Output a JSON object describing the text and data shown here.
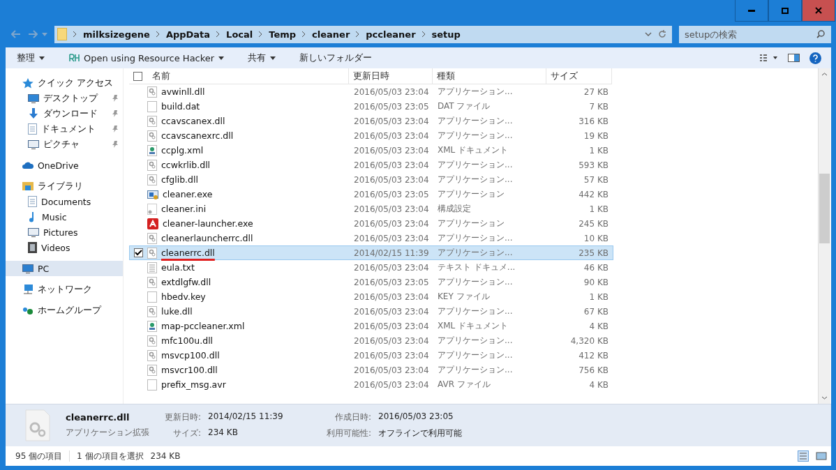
{
  "address": {
    "crumbs": [
      "milksizegene",
      "AppData",
      "Local",
      "Temp",
      "cleaner",
      "pccleaner",
      "setup"
    ]
  },
  "search": {
    "placeholder": "setupの検索"
  },
  "toolbar": [
    {
      "label": "整理",
      "kind": "menu"
    },
    {
      "label": "Open using Resource Hacker",
      "kind": "app"
    },
    {
      "label": "共有",
      "kind": "menu"
    },
    {
      "label": "新しいフォルダー",
      "kind": "plain"
    }
  ],
  "sidebar": [
    {
      "label": "クイック アクセス",
      "kind": "star",
      "selected": false,
      "children": [
        {
          "label": "デスクトップ",
          "kind": "desktop",
          "pinned": true,
          "selected": false
        },
        {
          "label": "ダウンロード",
          "kind": "download",
          "pinned": true,
          "selected": false
        },
        {
          "label": "ドキュメント",
          "kind": "document",
          "pinned": true,
          "selected": false
        },
        {
          "label": "ピクチャ",
          "kind": "picture",
          "pinned": true,
          "selected": false
        }
      ]
    },
    {
      "label": "OneDrive",
      "kind": "cloud",
      "selected": false
    },
    {
      "label": "ライブラリ",
      "kind": "library",
      "selected": false,
      "children": [
        {
          "label": "Documents",
          "kind": "document",
          "pinned": false,
          "selected": false
        },
        {
          "label": "Music",
          "kind": "music",
          "pinned": false,
          "selected": false
        },
        {
          "label": "Pictures",
          "kind": "picture",
          "pinned": false,
          "selected": false
        },
        {
          "label": "Videos",
          "kind": "video",
          "pinned": false,
          "selected": false
        }
      ]
    },
    {
      "label": "PC",
      "kind": "pc",
      "selected": true
    },
    {
      "label": "ネットワーク",
      "kind": "network",
      "selected": false
    },
    {
      "label": "ホームグループ",
      "kind": "homegroup",
      "selected": false
    }
  ],
  "table": {
    "select_all": {
      "checked": false
    },
    "columns": [
      "名前",
      "更新日時",
      "種類",
      "サイズ"
    ],
    "rows": [
      {
        "name": "avwinll.dll",
        "date": "2016/05/03 23:04",
        "type": "アプリケーション...",
        "size": "27 KB",
        "kind": "dll",
        "selected": false
      },
      {
        "name": "build.dat",
        "date": "2016/05/03 23:05",
        "type": "DAT ファイル",
        "size": "7 KB",
        "kind": "blank",
        "selected": false
      },
      {
        "name": "ccavscanex.dll",
        "date": "2016/05/03 23:04",
        "type": "アプリケーション...",
        "size": "316 KB",
        "kind": "dll",
        "selected": false
      },
      {
        "name": "ccavscanexrc.dll",
        "date": "2016/05/03 23:04",
        "type": "アプリケーション...",
        "size": "19 KB",
        "kind": "dll",
        "selected": false
      },
      {
        "name": "ccplg.xml",
        "date": "2016/05/03 23:04",
        "type": "XML ドキュメント",
        "size": "1 KB",
        "kind": "xml",
        "selected": false
      },
      {
        "name": "ccwkrlib.dll",
        "date": "2016/05/03 23:04",
        "type": "アプリケーション...",
        "size": "593 KB",
        "kind": "dll",
        "selected": false
      },
      {
        "name": "cfglib.dll",
        "date": "2016/05/03 23:04",
        "type": "アプリケーション...",
        "size": "57 KB",
        "kind": "dll",
        "selected": false
      },
      {
        "name": "cleaner.exe",
        "date": "2016/05/03 23:05",
        "type": "アプリケーション",
        "size": "442 KB",
        "kind": "exe",
        "selected": false
      },
      {
        "name": "cleaner.ini",
        "date": "2016/05/03 23:04",
        "type": "構成設定",
        "size": "1 KB",
        "kind": "ini",
        "selected": false
      },
      {
        "name": "cleaner-launcher.exe",
        "date": "2016/05/03 23:04",
        "type": "アプリケーション",
        "size": "245 KB",
        "kind": "logo",
        "selected": false
      },
      {
        "name": "cleanerlauncherrc.dll",
        "date": "2016/05/03 23:04",
        "type": "アプリケーション...",
        "size": "10 KB",
        "kind": "dll",
        "selected": false
      },
      {
        "name": "cleanerrc.dll",
        "date": "2014/02/15 11:39",
        "type": "アプリケーション...",
        "size": "235 KB",
        "kind": "dll",
        "selected": true
      },
      {
        "name": "eula.txt",
        "date": "2016/05/03 23:04",
        "type": "テキスト ドキュメ...",
        "size": "46 KB",
        "kind": "txt",
        "selected": false
      },
      {
        "name": "extdlgfw.dll",
        "date": "2016/05/03 23:05",
        "type": "アプリケーション...",
        "size": "90 KB",
        "kind": "dll",
        "selected": false
      },
      {
        "name": "hbedv.key",
        "date": "2016/05/03 23:04",
        "type": "KEY ファイル",
        "size": "1 KB",
        "kind": "blank",
        "selected": false
      },
      {
        "name": "luke.dll",
        "date": "2016/05/03 23:04",
        "type": "アプリケーション...",
        "size": "67 KB",
        "kind": "dll",
        "selected": false
      },
      {
        "name": "map-pccleaner.xml",
        "date": "2016/05/03 23:04",
        "type": "XML ドキュメント",
        "size": "4 KB",
        "kind": "xml",
        "selected": false
      },
      {
        "name": "mfc100u.dll",
        "date": "2016/05/03 23:04",
        "type": "アプリケーション...",
        "size": "4,320 KB",
        "kind": "dll",
        "selected": false
      },
      {
        "name": "msvcp100.dll",
        "date": "2016/05/03 23:04",
        "type": "アプリケーション...",
        "size": "412 KB",
        "kind": "dll",
        "selected": false
      },
      {
        "name": "msvcr100.dll",
        "date": "2016/05/03 23:04",
        "type": "アプリケーション...",
        "size": "756 KB",
        "kind": "dll",
        "selected": false
      },
      {
        "name": "prefix_msg.avr",
        "date": "2016/05/03 23:04",
        "type": "AVR ファイル",
        "size": "4 KB",
        "kind": "blank",
        "selected": false
      }
    ]
  },
  "details": {
    "name": "cleanerrc.dll",
    "type": "アプリケーション拡張",
    "fields": [
      {
        "label": "更新日時:",
        "value": "2014/02/15 11:39"
      },
      {
        "label": "作成日時:",
        "value": "2016/05/03 23:05"
      },
      {
        "label": "サイズ:",
        "value": "234 KB"
      },
      {
        "label": "利用可能性:",
        "value": "オフラインで利用可能"
      }
    ]
  },
  "status_bar": {
    "count": "95 個の項目",
    "selection": "1 個の項目を選択",
    "size": "234 KB"
  }
}
